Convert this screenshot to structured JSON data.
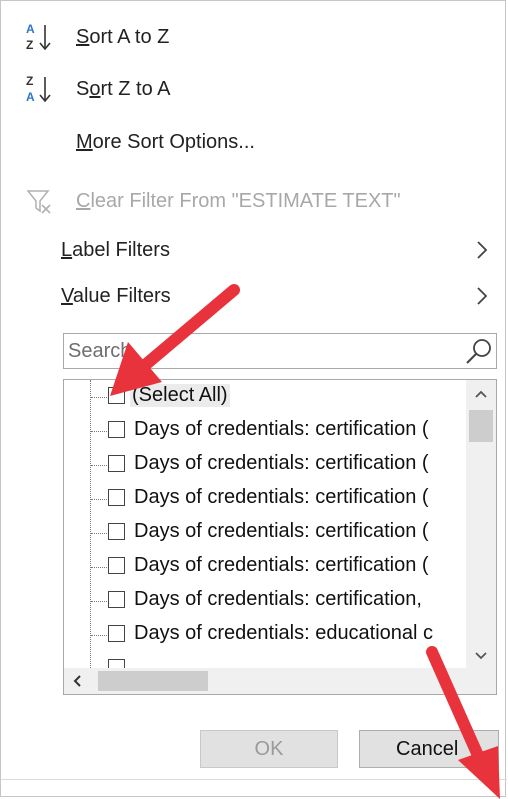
{
  "menu": {
    "sort_az": {
      "pre": "",
      "u": "S",
      "post": "ort A to Z"
    },
    "sort_za": {
      "pre": "S",
      "u": "o",
      "post": "rt Z to A"
    },
    "more_sort": {
      "pre": "",
      "u": "M",
      "post": "ore Sort Options..."
    },
    "clear_filter": {
      "pre": "",
      "u": "C",
      "post": "lear Filter From \"ESTIMATE TEXT\""
    },
    "label_filters": {
      "pre": "",
      "u": "L",
      "post": "abel Filters"
    },
    "value_filters": {
      "pre": "",
      "u": "V",
      "post": "alue Filters"
    }
  },
  "icons": {
    "sort_az": "sort-a-to-z-icon",
    "sort_za": "sort-z-to-a-icon",
    "clear_filter": "clear-filter-icon",
    "search": "search-icon",
    "chevron": "chevron-right-icon"
  },
  "search": {
    "placeholder": "Search"
  },
  "list": {
    "items": [
      {
        "label": "(Select All)",
        "checked": false
      },
      {
        "label": "Days of credentials: certification (",
        "checked": false
      },
      {
        "label": "Days of credentials: certification (",
        "checked": false
      },
      {
        "label": "Days of credentials: certification (",
        "checked": false
      },
      {
        "label": "Days of credentials: certification (",
        "checked": false
      },
      {
        "label": "Days of credentials: certification (",
        "checked": false
      },
      {
        "label": "Days of credentials: certification,",
        "checked": false
      },
      {
        "label": "Days of credentials: educational c",
        "checked": false
      }
    ]
  },
  "buttons": {
    "ok": "OK",
    "cancel": "Cancel"
  },
  "colors": {
    "accent_blue": "#2b78c8",
    "annotation_red": "#e8323c",
    "disabled_text": "#a8a8a8"
  }
}
